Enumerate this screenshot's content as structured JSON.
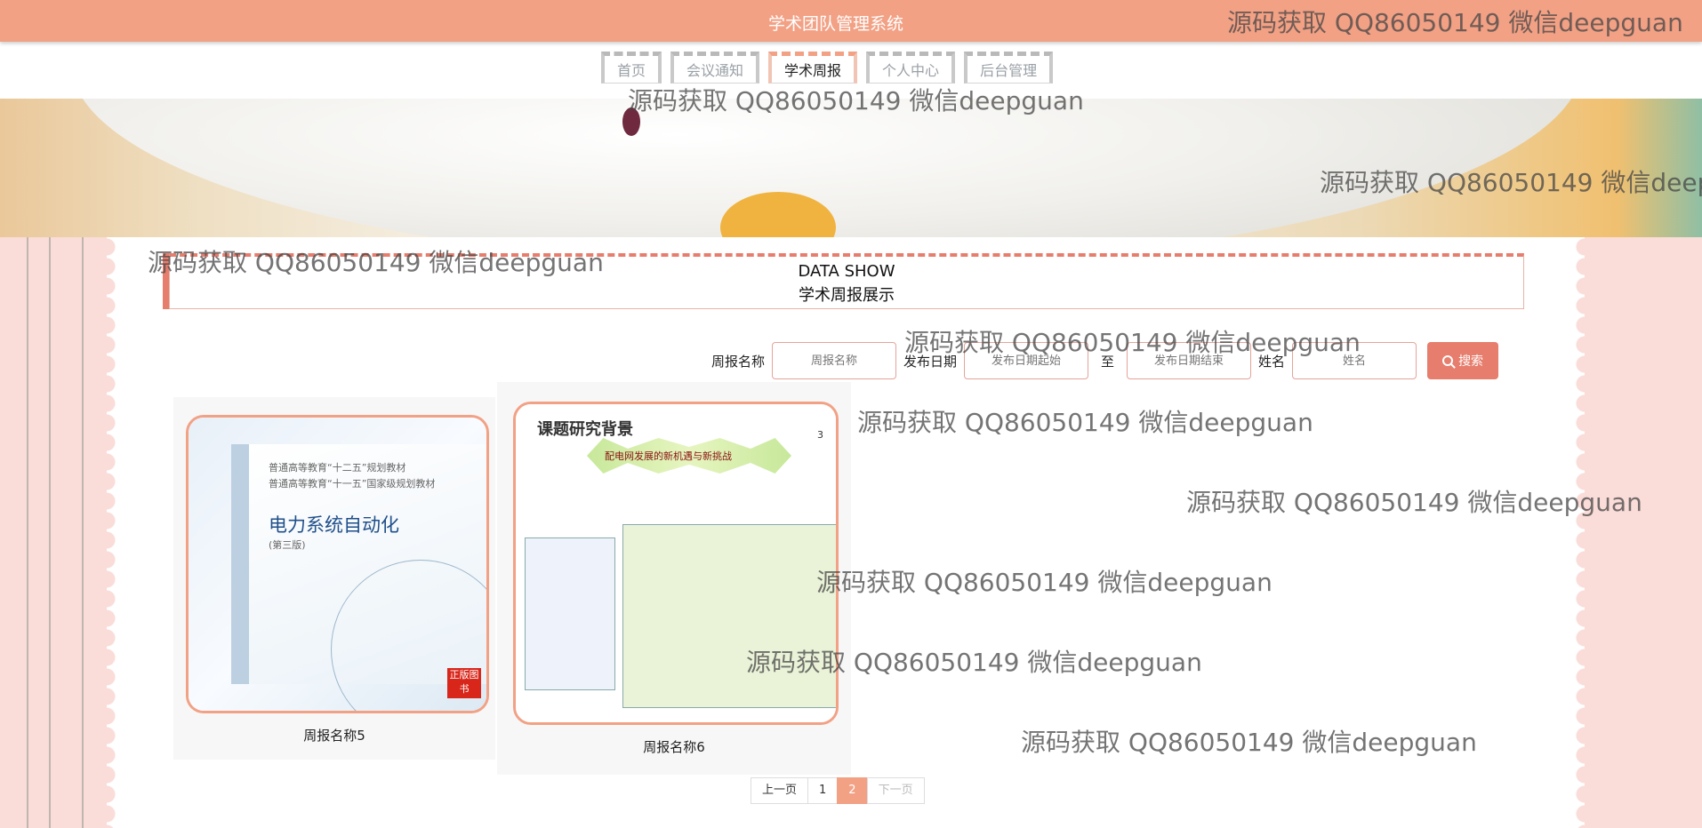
{
  "header": {
    "title": "学术团队管理系统"
  },
  "nav": {
    "items": [
      "首页",
      "会议通知",
      "学术周报",
      "个人中心",
      "后台管理"
    ],
    "active": "学术周报"
  },
  "section": {
    "title_en": "DATA SHOW",
    "title_cn": "学术周报展示"
  },
  "search": {
    "name_label": "周报名称",
    "name_placeholder": "周报名称",
    "date_label": "发布日期",
    "start_placeholder": "发布日期起始",
    "to_label": "至",
    "end_placeholder": "发布日期结束",
    "person_label": "姓名",
    "person_placeholder": "姓名",
    "button_label": "搜索"
  },
  "cards": [
    {
      "name": "周报名称5",
      "cover": {
        "series_1": "普通高等教育“十二五”规划教材",
        "series_2": "普通高等教育“十一五”国家级规划教材",
        "title": "电力系统自动化",
        "edition": "(第三版)",
        "stamp": "正版图书"
      }
    },
    {
      "name": "周报名称6",
      "cover": {
        "heading": "课题研究背景",
        "banner": "配电网发展的新机遇与新挑战",
        "page": "3"
      }
    }
  ],
  "pagination": {
    "prev": "上一页",
    "pages": [
      "1",
      "2"
    ],
    "current": "2",
    "next": "下一页"
  },
  "watermark": {
    "text": "源码获取 QQ86050149 微信deepguan"
  },
  "colors": {
    "primary": "#f2a185",
    "accent": "#e67d6d",
    "background": "#fadcd8"
  }
}
